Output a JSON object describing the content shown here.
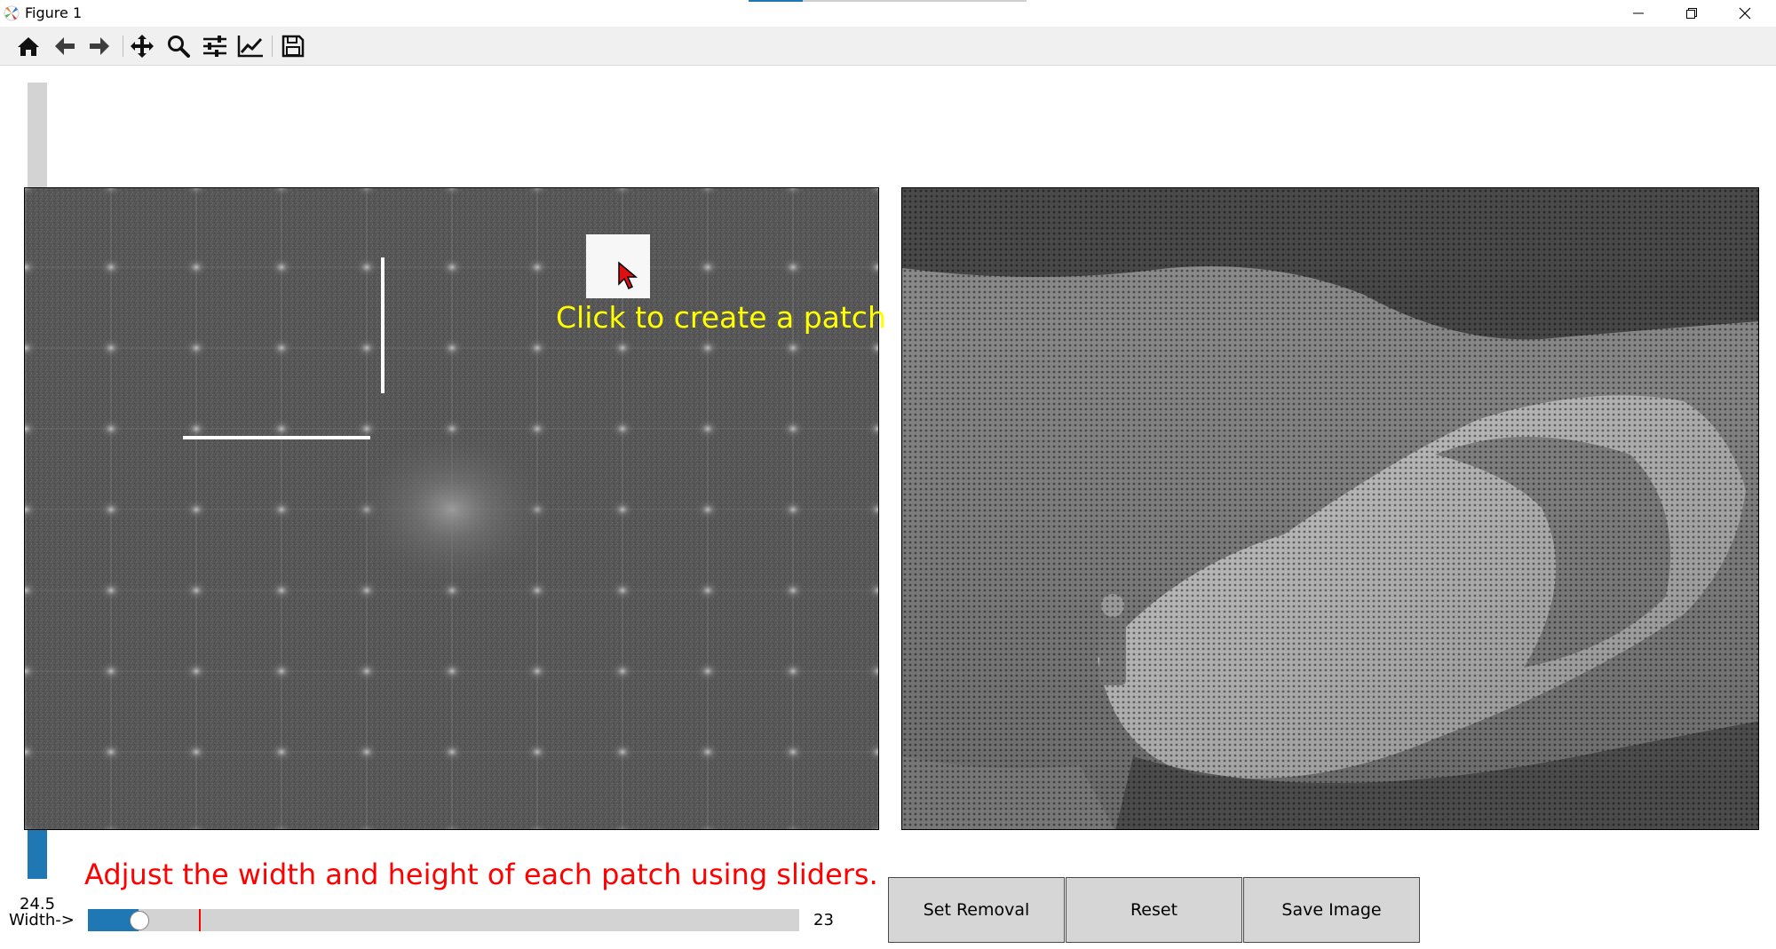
{
  "window": {
    "title": "Figure 1",
    "controls": [
      "minimize",
      "restore",
      "close"
    ]
  },
  "toolbar": {
    "tools": [
      {
        "name": "home",
        "icon": "home-icon",
        "tooltip": "Reset original view"
      },
      {
        "name": "back",
        "icon": "arrow-left-icon",
        "tooltip": "Back to previous view"
      },
      {
        "name": "forward",
        "icon": "arrow-right-icon",
        "tooltip": "Forward to next view"
      },
      {
        "name": "pan",
        "icon": "move-icon",
        "tooltip": "Pan axes"
      },
      {
        "name": "zoom",
        "icon": "magnifier-icon",
        "tooltip": "Zoom to rectangle"
      },
      {
        "name": "subplots",
        "icon": "sliders-icon",
        "tooltip": "Configure subplots"
      },
      {
        "name": "edit-axes",
        "icon": "line-chart-icon",
        "tooltip": "Edit axis"
      },
      {
        "name": "save",
        "icon": "floppy-disk-icon",
        "tooltip": "Save the figure"
      }
    ]
  },
  "figure": {
    "hint": "Click to create a patch",
    "instruction": "Adjust the width and height of each patch using sliders.",
    "height_slider": {
      "value": 24.5,
      "value_label": "24.5",
      "fill_fraction": 0.097,
      "initial_fraction": 0.207
    },
    "width_slider": {
      "label": "Width->",
      "value": 23,
      "value_label": "23",
      "fill_fraction": 0.07,
      "initial_fraction": 0.157
    },
    "buttons": {
      "set_removal": "Set Removal",
      "reset": "Reset",
      "save_image": "Save Image"
    }
  },
  "colors": {
    "accent": "#1f77b4",
    "hint_text": "#ffff00",
    "instruction_text": "#ff0000",
    "slider_initial_marker": "#ff0000",
    "button_face": "#d6d6d6"
  }
}
